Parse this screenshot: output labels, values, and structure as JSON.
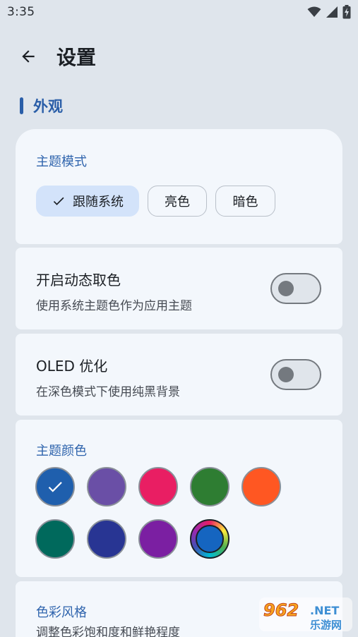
{
  "status_bar": {
    "time": "3:35",
    "icons": [
      "wifi-icon",
      "signal-icon",
      "battery-charging-icon"
    ]
  },
  "header": {
    "title": "设置",
    "back_icon": "arrow-back-icon"
  },
  "section": {
    "title": "外观"
  },
  "theme_mode": {
    "label": "主题模式",
    "options": [
      "跟随系统",
      "亮色",
      "暗色"
    ],
    "selected": "跟随系统"
  },
  "dynamic_color": {
    "title": "开启动态取色",
    "description": "使用系统主题色作为应用主题",
    "enabled": false
  },
  "oled": {
    "title": "OLED 优化",
    "description": "在深色模式下使用纯黑背景",
    "enabled": false
  },
  "theme_color": {
    "label": "主题颜色",
    "swatches": [
      "#1f5fad",
      "#6a4fa6",
      "#e91e63",
      "#2e7d32",
      "#ff5722",
      "#00695c",
      "#283593",
      "#7b1fa2",
      "#1565c0"
    ],
    "selected_index": 0,
    "custom_index": 8
  },
  "color_style": {
    "title": "色彩风格",
    "description": "调整色彩饱和度和鲜艳程度"
  },
  "watermark": {
    "number": "962",
    "suffix": ".NET",
    "text": "乐游网"
  },
  "colors": {
    "accent": "#2f64ad",
    "card_background": "#f3f7fc",
    "page_background": "#dfe5ec",
    "chip_selected": "#d3e3fa"
  }
}
